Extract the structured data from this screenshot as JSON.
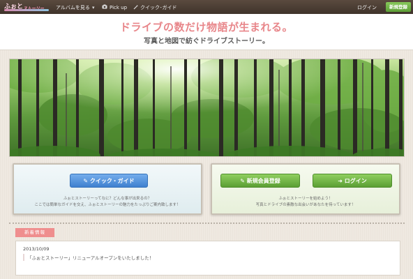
{
  "topbar": {
    "logo_main": "ふぉと",
    "logo_sub": "ストーリー",
    "nav": {
      "albums": "アルバムを見る",
      "pickup": "Pick up",
      "guide": "クイック･ガイド"
    },
    "login": "ログイン",
    "register": "新規登録"
  },
  "header": {
    "tagline_main": "ドライブの数だけ物語が生まれる。",
    "tagline_sub": "写真と地図で紡ぐドライブストーリー。"
  },
  "panels": {
    "guide": {
      "button": "クイック・ガイド",
      "desc_line1": "ふぉとストーリーってなに？どんな事が出来るの？",
      "desc_line2": "ここでは簡単なガイドを交え、ふぉとストーリーの魅力をたっぷりご案内致します！"
    },
    "member": {
      "register_button": "新規会員登録",
      "login_button": "ログイン",
      "desc_line1": "ふぉとストーリーを始めよう！",
      "desc_line2": "写真とドライブの素敵な出会いがあなたを待っています！"
    }
  },
  "news": {
    "label": "新着情報",
    "date": "2013/10/09",
    "text": "「ふぉとストーリー」リニューアルオープンをいたしました！"
  },
  "colors": {
    "topbar": "#4a3d34",
    "tagline": "#e8868a",
    "blue_button": "#4a8ad8",
    "green_button": "#6bb042",
    "news_label": "#ef8e8e"
  }
}
